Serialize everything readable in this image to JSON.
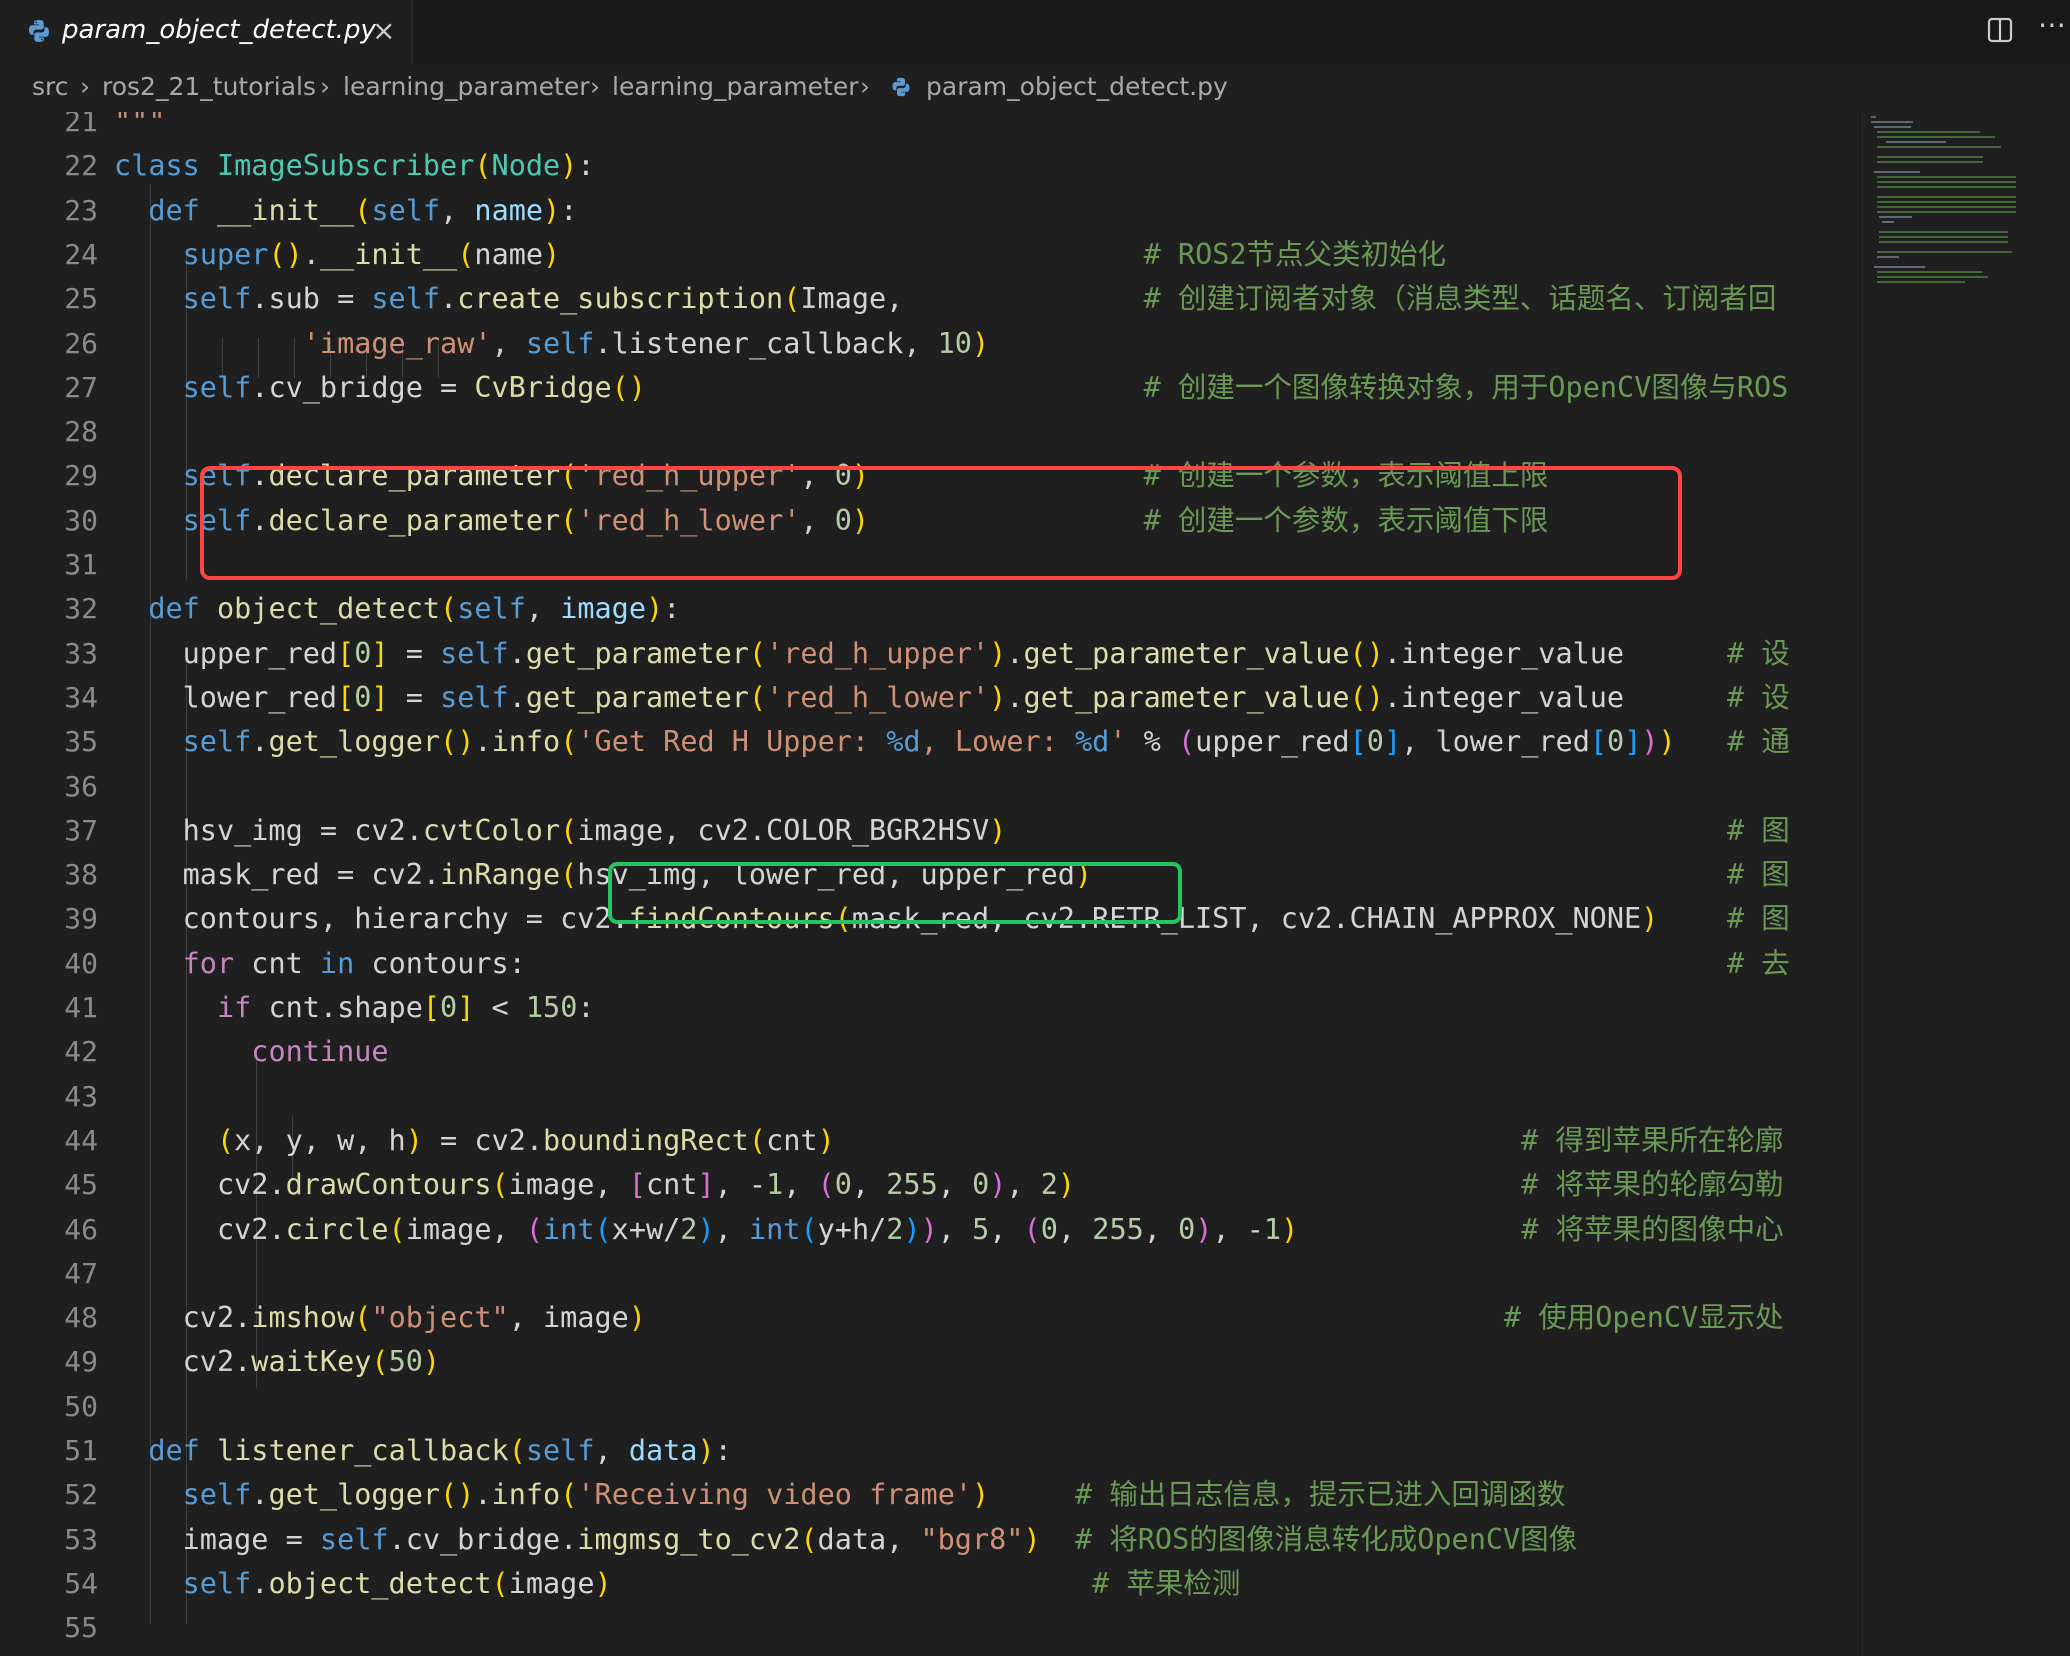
{
  "tab": {
    "title": "param_object_detect.py",
    "close_glyph": "×",
    "icon": "python-file-icon"
  },
  "toolbar": {
    "split_icon": "split-editor-icon",
    "more_glyph": "⋯"
  },
  "breadcrumb": [
    "src",
    "ros2_21_tutorials",
    "learning_parameter",
    "learning_parameter",
    "param_object_detect.py"
  ],
  "colors": {
    "keyword": "#569cd6",
    "class_name": "#4ec9b0",
    "function": "#dcdcaa",
    "parameter": "#9cdcfe",
    "string": "#ce9178",
    "number": "#b5cea8",
    "comment": "#6a9955",
    "control": "#c586c0",
    "bracket1": "#ffd700",
    "bracket2": "#da70d6",
    "bracket3": "#179fff",
    "highlight_red": "#ff4444",
    "highlight_green": "#22c55e"
  },
  "code_lines": [
    {
      "n": "21",
      "text": "\"\"\""
    },
    {
      "n": "22",
      "text": "class ImageSubscriber(Node):"
    },
    {
      "n": "23",
      "text": "  def __init__(self, name):"
    },
    {
      "n": "24",
      "text": "    super().__init__(name)                                  # ROS2节点父类初始化"
    },
    {
      "n": "25",
      "text": "    self.sub = self.create_subscription(Image,              # 创建订阅者对象（消息类型、话题名、订阅者回"
    },
    {
      "n": "26",
      "text": "           'image_raw', self.listener_callback, 10)"
    },
    {
      "n": "27",
      "text": "    self.cv_bridge = CvBridge()                             # 创建一个图像转换对象，用于OpenCV图像与ROS"
    },
    {
      "n": "28",
      "text": ""
    },
    {
      "n": "29",
      "text": "    self.declare_parameter('red_h_upper', 0)                # 创建一个参数，表示阈值上限"
    },
    {
      "n": "30",
      "text": "    self.declare_parameter('red_h_lower', 0)                # 创建一个参数，表示阈值下限"
    },
    {
      "n": "31",
      "text": ""
    },
    {
      "n": "32",
      "text": "  def object_detect(self, image):"
    },
    {
      "n": "33",
      "text": "    upper_red[0] = self.get_parameter('red_h_upper').get_parameter_value().integer_value      # 设"
    },
    {
      "n": "34",
      "text": "    lower_red[0] = self.get_parameter('red_h_lower').get_parameter_value().integer_value      # 设"
    },
    {
      "n": "35",
      "text": "    self.get_logger().info('Get Red H Upper: %d, Lower: %d' % (upper_red[0], lower_red[0]))   # 通"
    },
    {
      "n": "36",
      "text": ""
    },
    {
      "n": "37",
      "text": "    hsv_img = cv2.cvtColor(image, cv2.COLOR_BGR2HSV)                                          # 图"
    },
    {
      "n": "38",
      "text": "    mask_red = cv2.inRange(hsv_img, lower_red, upper_red)                                     # 图"
    },
    {
      "n": "39",
      "text": "    contours, hierarchy = cv2.findContours(mask_red, cv2.RETR_LIST, cv2.CHAIN_APPROX_NONE)    # 图"
    },
    {
      "n": "40",
      "text": "    for cnt in contours:                                                                      # 去"
    },
    {
      "n": "41",
      "text": "      if cnt.shape[0] < 150:"
    },
    {
      "n": "42",
      "text": "        continue"
    },
    {
      "n": "43",
      "text": ""
    },
    {
      "n": "44",
      "text": "      (x, y, w, h) = cv2.boundingRect(cnt)                                        # 得到苹果所在轮廓"
    },
    {
      "n": "45",
      "text": "      cv2.drawContours(image, [cnt], -1, (0, 255, 0), 2)                          # 将苹果的轮廓勾勒"
    },
    {
      "n": "46",
      "text": "      cv2.circle(image, (int(x+w/2), int(y+h/2)), 5, (0, 255, 0), -1)             # 将苹果的图像中心"
    },
    {
      "n": "47",
      "text": ""
    },
    {
      "n": "48",
      "text": "    cv2.imshow(\"object\", image)                                                  # 使用OpenCV显示处"
    },
    {
      "n": "49",
      "text": "    cv2.waitKey(50)"
    },
    {
      "n": "50",
      "text": ""
    },
    {
      "n": "51",
      "text": "  def listener_callback(self, data):"
    },
    {
      "n": "52",
      "text": "    self.get_logger().info('Receiving video frame')     # 输出日志信息，提示已进入回调函数"
    },
    {
      "n": "53",
      "text": "    image = self.cv_bridge.imgmsg_to_cv2(data, \"bgr8\")  # 将ROS的图像消息转化成OpenCV图像"
    },
    {
      "n": "54",
      "text": "    self.object_detect(image)                            # 苹果检测"
    },
    {
      "n": "55",
      "text": ""
    }
  ]
}
